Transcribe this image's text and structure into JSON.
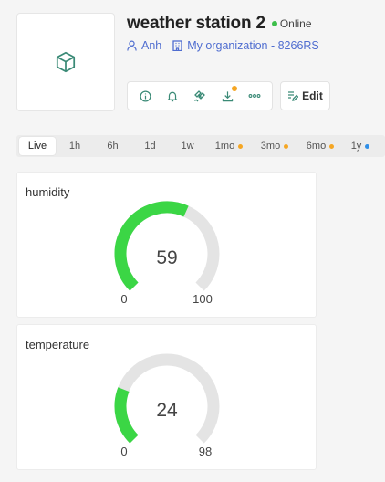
{
  "device": {
    "title": "weather station 2",
    "status": "Online",
    "user": "Anh",
    "organization": "My organization - 8266RS",
    "icon": "cube-icon"
  },
  "toolbar": {
    "items": [
      {
        "name": "info-icon"
      },
      {
        "name": "bell-icon"
      },
      {
        "name": "satellite-icon"
      },
      {
        "name": "download-icon",
        "badge": true
      },
      {
        "name": "more-icon"
      }
    ],
    "edit_label": "Edit"
  },
  "time_range": {
    "tabs": [
      {
        "label": "Live",
        "active": true
      },
      {
        "label": "1h"
      },
      {
        "label": "6h"
      },
      {
        "label": "1d"
      },
      {
        "label": "1w"
      },
      {
        "label": "1mo",
        "dot": "#f5a623"
      },
      {
        "label": "3mo",
        "dot": "#f5a623"
      },
      {
        "label": "6mo",
        "dot": "#f5a623"
      },
      {
        "label": "1y",
        "dot": "#2f8fe8"
      }
    ]
  },
  "widgets": [
    {
      "title": "humidity",
      "value": 59,
      "min": 0,
      "max": 100
    },
    {
      "title": "temperature",
      "value": 24,
      "min": 0,
      "max": 98
    }
  ],
  "colors": {
    "accent": "#3bd645",
    "track": "#e4e4e4",
    "link": "#4f6dd0",
    "online": "#3dbf4a",
    "icon": "#3a8a76"
  }
}
